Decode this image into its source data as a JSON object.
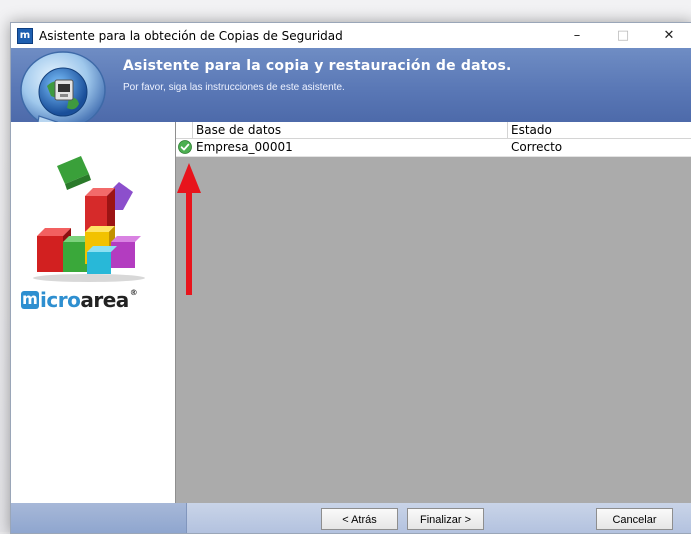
{
  "window": {
    "title": "Asistente para la obteción de Copias de Seguridad",
    "app_icon_letter": "m",
    "controls": {
      "minimize": "–",
      "maximize": "□",
      "close": "✕"
    }
  },
  "header": {
    "title": "Asistente para la copia y restauración de datos.",
    "subtitle": "Por favor, siga las instrucciones de este asistente."
  },
  "branding": {
    "logo_mark": "m",
    "logo_text_a": "icro",
    "logo_text_b": "area",
    "logo_sup": "®"
  },
  "table": {
    "columns": [
      "Base de datos",
      "Estado"
    ],
    "rows": [
      {
        "database": "Empresa_00001",
        "status": "Correcto",
        "status_icon": "check-circle-icon"
      }
    ]
  },
  "buttons": {
    "back": "< Atrás",
    "finish": "Finalizar >",
    "cancel": "Cancelar"
  },
  "colors": {
    "header_bg": "#5a78b6",
    "list_bg": "#ababab",
    "arrow": "#e8141c",
    "check": "#4caf50"
  }
}
